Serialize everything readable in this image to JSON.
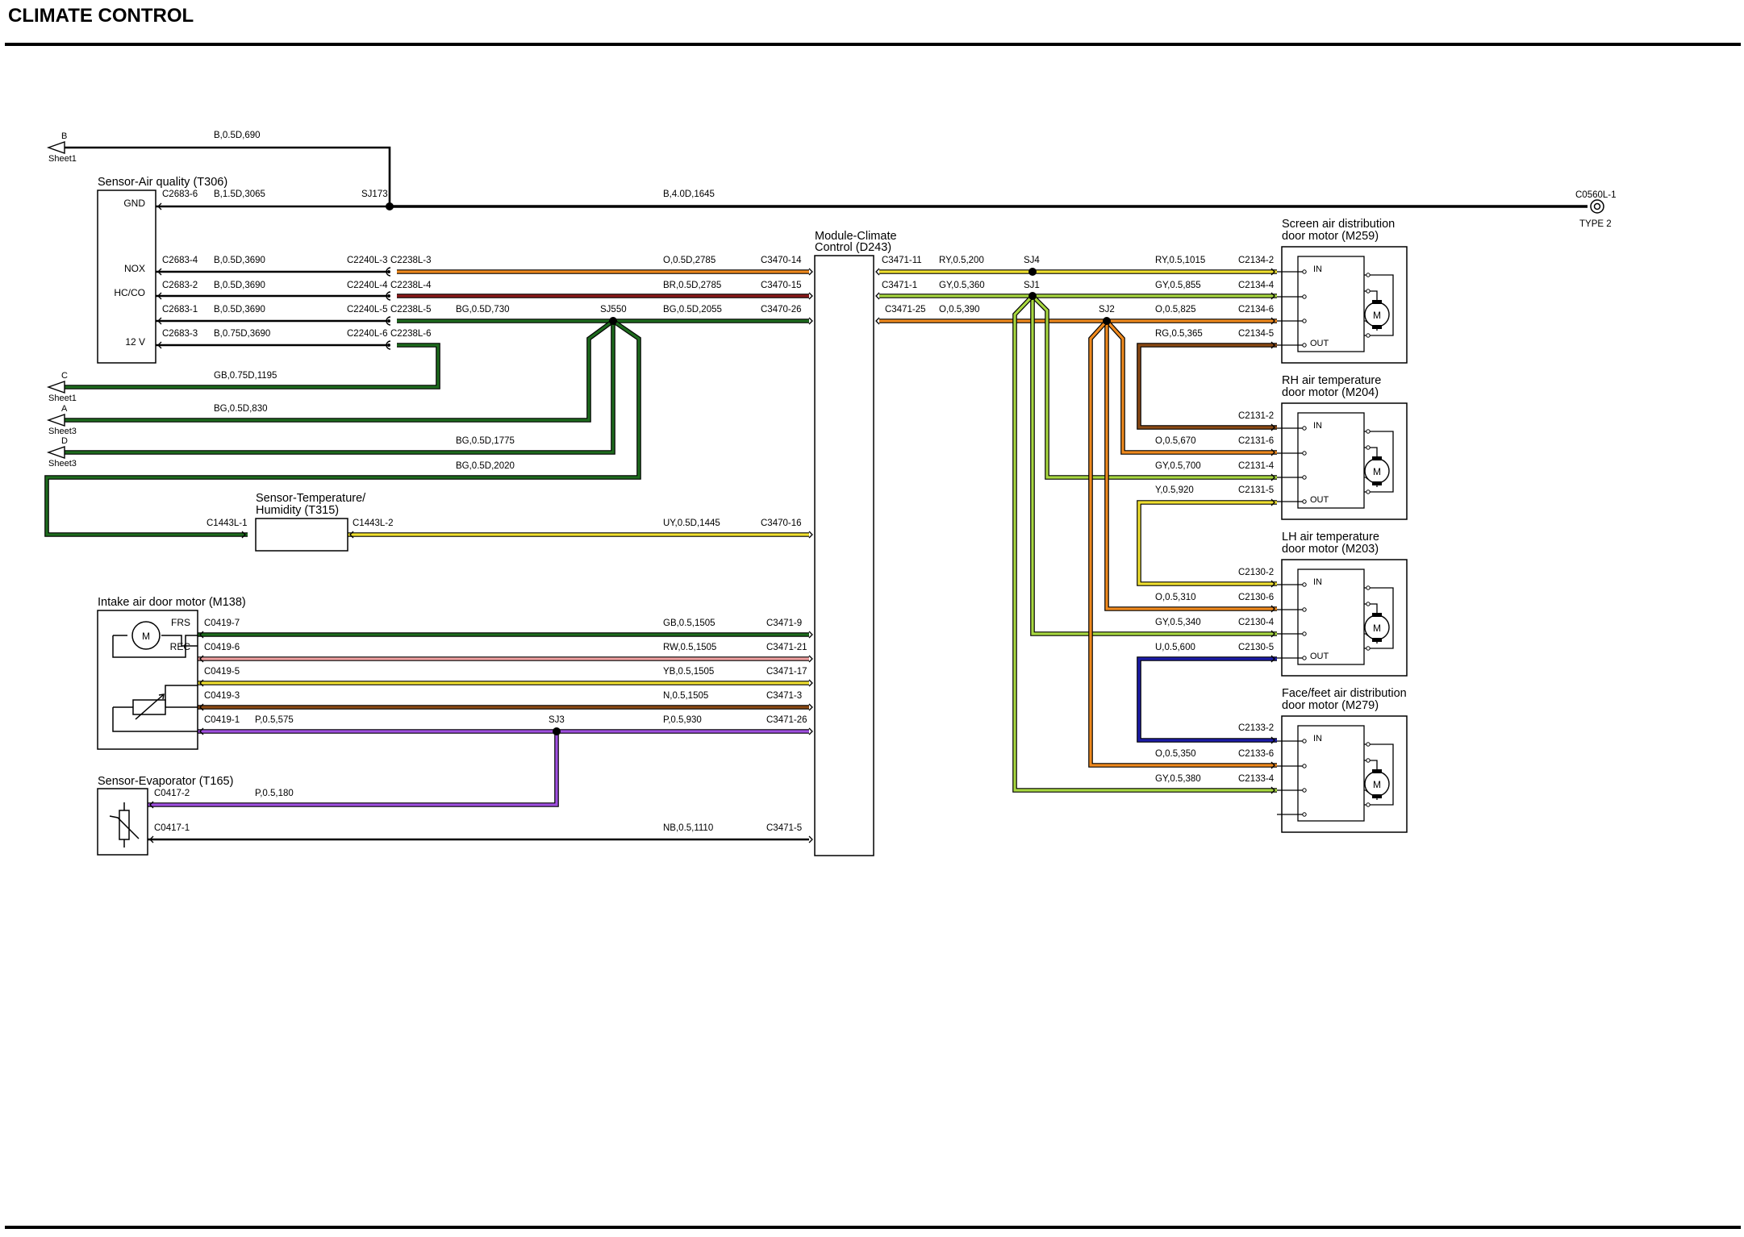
{
  "title": "CLIMATE CONTROL",
  "offsheet": [
    {
      "letter": "B",
      "sheet": "Sheet1"
    },
    {
      "letter": "C",
      "sheet": "Sheet1"
    },
    {
      "letter": "A",
      "sheet": "Sheet3"
    },
    {
      "letter": "D",
      "sheet": "Sheet3"
    }
  ],
  "ground": {
    "connector": "C0560L-1",
    "type": "TYPE 2"
  },
  "components": {
    "air_quality": {
      "name": "Sensor-Air quality (T306)",
      "pins": [
        "GND",
        "NOX",
        "HC/CO",
        "12 V"
      ]
    },
    "temp_humidity": {
      "name_line1": "Sensor-Temperature/",
      "name_line2": "Humidity (T315)"
    },
    "intake_motor": {
      "name": "Intake air door motor (M138)",
      "pins": [
        "FRS",
        "REC"
      ],
      "motor": "M"
    },
    "evaporator": {
      "name": "Sensor-Evaporator (T165)"
    },
    "module": {
      "name_line1": "Module-Climate",
      "name_line2": "Control (D243)"
    },
    "screen_motor": {
      "name_line1": "Screen air distribution",
      "name_line2": "door motor (M259)",
      "in": "IN",
      "out": "OUT",
      "motor": "M"
    },
    "rh_motor": {
      "name_line1": "RH air temperature",
      "name_line2": "door motor (M204)",
      "in": "IN",
      "out": "OUT",
      "motor": "M"
    },
    "lh_motor": {
      "name_line1": "LH air temperature",
      "name_line2": "door motor (M203)",
      "in": "IN",
      "out": "OUT",
      "motor": "M"
    },
    "face_motor": {
      "name_line1": "Face/feet air distribution",
      "name_line2": "door motor (M279)",
      "in": "IN",
      "motor": "M"
    }
  },
  "splices": [
    "SJ173",
    "SJ550",
    "SJ3",
    "SJ4",
    "SJ1",
    "SJ2"
  ],
  "colors": {
    "black": "#000000",
    "orange": "#f08a1e",
    "brown_red": "#8b1a1a",
    "green": "#1e6b1e",
    "yellow": "#f0e030",
    "purple": "#a050e0",
    "blue": "#1c1ca8",
    "lime": "#a8d840",
    "brown": "#8b4a14",
    "pink": "#f0a0a0",
    "gray": "#909090"
  },
  "wires": [
    {
      "label": "B,0.5D,690"
    },
    {
      "label": "B,1.5D,3065"
    },
    {
      "label": "B,4.0D,1645"
    },
    {
      "label": "B,0.5D,3690"
    },
    {
      "label": "B,0.5D,3690"
    },
    {
      "label": "B,0.5D,3690"
    },
    {
      "label": "B,0.75D,3690"
    },
    {
      "label": "O,0.5D,2785"
    },
    {
      "label": "BR,0.5D,2785"
    },
    {
      "label": "BG,0.5D,730"
    },
    {
      "label": "BG,0.5D,2055"
    },
    {
      "label": "GB,0.75D,1195"
    },
    {
      "label": "BG,0.5D,830"
    },
    {
      "label": "BG,0.5D,1775"
    },
    {
      "label": "BG,0.5D,2020"
    },
    {
      "label": "UY,0.5D,1445"
    },
    {
      "label": "GB,0.5,1505"
    },
    {
      "label": "RW,0.5,1505"
    },
    {
      "label": "YB,0.5,1505"
    },
    {
      "label": "N,0.5,1505"
    },
    {
      "label": "P,0.5,575"
    },
    {
      "label": "P,0.5,930"
    },
    {
      "label": "P,0.5,180"
    },
    {
      "label": "NB,0.5,1110"
    },
    {
      "label": "RY,0.5,200"
    },
    {
      "label": "GY,0.5,360"
    },
    {
      "label": "O,0.5,390"
    },
    {
      "label": "RY,0.5,1015"
    },
    {
      "label": "GY,0.5,855"
    },
    {
      "label": "O,0.5,825"
    },
    {
      "label": "RG,0.5,365"
    },
    {
      "label": "O,0.5,670"
    },
    {
      "label": "GY,0.5,700"
    },
    {
      "label": "Y,0.5,920"
    },
    {
      "label": "O,0.5,310"
    },
    {
      "label": "GY,0.5,340"
    },
    {
      "label": "U,0.5,600"
    },
    {
      "label": "O,0.5,350"
    },
    {
      "label": "GY,0.5,380"
    }
  ],
  "connectors": [
    "C2683-6",
    "C2683-4",
    "C2683-2",
    "C2683-1",
    "C2683-3",
    "C2240L-3",
    "C2238L-3",
    "C2240L-4",
    "C2238L-4",
    "C2240L-5",
    "C2238L-5",
    "C2240L-6",
    "C2238L-6",
    "C3470-14",
    "C3470-15",
    "C3470-26",
    "C3470-16",
    "C1443L-1",
    "C1443L-2",
    "C0419-7",
    "C0419-6",
    "C0419-5",
    "C0419-3",
    "C0419-1",
    "C3471-9",
    "C3471-21",
    "C3471-17",
    "C3471-3",
    "C3471-26",
    "C0417-2",
    "C0417-1",
    "C3471-5",
    "C3471-11",
    "C3471-1",
    "C3471-25",
    "C2134-2",
    "C2134-4",
    "C2134-6",
    "C2134-5",
    "C2131-2",
    "C2131-6",
    "C2131-4",
    "C2131-5",
    "C2130-2",
    "C2130-6",
    "C2130-4",
    "C2130-5",
    "C2133-2",
    "C2133-6",
    "C2133-4"
  ]
}
